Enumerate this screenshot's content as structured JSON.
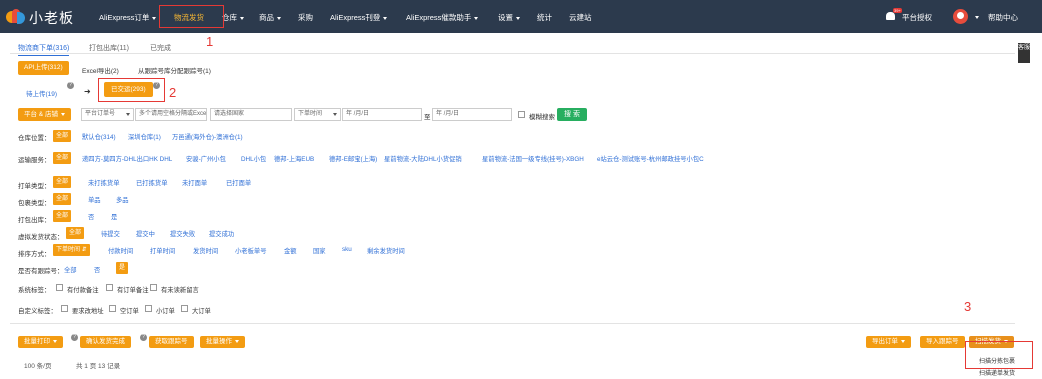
{
  "brand": "小老板",
  "nav": {
    "items": [
      {
        "label": "AliExpress订单",
        "caret": true
      },
      {
        "label": "物流发货",
        "caret": false
      },
      {
        "label": "仓库",
        "caret": true
      },
      {
        "label": "商品",
        "caret": true
      },
      {
        "label": "采购",
        "caret": false
      },
      {
        "label": "AliExpress刊登",
        "caret": true
      },
      {
        "label": "AliExpress催款助手",
        "caret": true
      },
      {
        "label": "设置",
        "caret": true
      },
      {
        "label": "统计",
        "caret": false
      },
      {
        "label": "云建站",
        "caret": false
      }
    ],
    "bell_badge": "39+",
    "auth": "平台授权",
    "help": "帮助中心"
  },
  "side_widget": "客服",
  "annotations": {
    "n1": "1",
    "n2": "2",
    "n3": "3"
  },
  "tabs": [
    {
      "label": "物流商下单(316)"
    },
    {
      "label": "打包出库(11)"
    },
    {
      "label": "已完成"
    }
  ],
  "subtabs": {
    "api": "API上传(312)",
    "excel": "Excel导出(2)",
    "from_lib": "从跟踪号库分配跟踪号(1)",
    "pending": "待上传(19)",
    "arrow": "➜",
    "submitted": "已交运(293)",
    "q": "?"
  },
  "search": {
    "platform_btn": "平台 & 店铺",
    "type_select": "平台订单号",
    "keyword_placeholder": "多个请用空格分隔或Excel",
    "country_placeholder": "请选择国家",
    "time_select": "下单时间",
    "date_from": "年 /月/日",
    "to": "至",
    "date_to": "年 /月/日",
    "fuzzy": "模糊搜索",
    "search_btn": "搜 索"
  },
  "filters": {
    "warehouse": {
      "label": "仓库位置：",
      "all": "全部",
      "options": [
        "默认仓(314)",
        "深圳仓库(1)",
        "万邑通(海外仓)-澳洲仓(1)"
      ]
    },
    "shipping": {
      "label": "运输服务：",
      "all": "全部",
      "options": [
        "递四方-莫四方-DHL出口HK DHL",
        "安骏-广州小包",
        "DHL小包",
        "德邦-上海EUB",
        "德邦-E邮宝(上海)",
        "星前物流-大陆DHL小货促销",
        "星前物流-法国一级专线(挂号)-XBGH",
        "e站云仓-测试账号-杭州邮政挂号小包C"
      ]
    },
    "print_type": {
      "label": "打单类型：",
      "all": "全部",
      "options": [
        "未打拣货单",
        "已打拣货单",
        "未打面单",
        "已打面单"
      ]
    },
    "package_type": {
      "label": "包裹类型：",
      "all": "全部",
      "options": [
        "单品",
        "多品"
      ]
    },
    "out_of_stock": {
      "label": "打包出库：",
      "all": "全部",
      "options": [
        "否",
        "是"
      ]
    },
    "virtual_ship": {
      "label": "虚拟发货状态：",
      "all": "全部",
      "options": [
        "待提交",
        "提交中",
        "提交失败",
        "提交成功"
      ]
    },
    "sort": {
      "label": "排序方式：",
      "active": "下单时间 ⇵",
      "options": [
        "付款时间",
        "打单时间",
        "发货时间",
        "小老板单号",
        "金额",
        "国家",
        "sku",
        "剩余发货时间"
      ]
    },
    "has_tracking": {
      "label": "是否有跟踪号：",
      "options": [
        "全部",
        "否"
      ],
      "active": "是"
    },
    "system_tags": {
      "label": "系统标签：",
      "options": [
        "有付款备注",
        "有订单备注",
        "有未读新留言"
      ]
    },
    "custom_tags": {
      "label": "自定义标签：",
      "options": [
        "要求改地址",
        "空订单",
        "小订单",
        "大订单"
      ]
    }
  },
  "actions": {
    "batch_print": "批量打印",
    "confirm_ship": "确认发货完成",
    "get_tracking": "获取跟踪号",
    "batch_ops": "批量操作",
    "export": "导出订单",
    "import_tracking": "导入跟踪号",
    "scan_ship": "扫描发货",
    "dropdown": [
      "扫描分拣包裹",
      "扫描递单发货"
    ]
  },
  "pagination": {
    "per_page": "100 条/页",
    "total": "共 1 页 13 记录"
  },
  "colors": {
    "nav_bg": "#2c3a4d",
    "accent": "#f39c12",
    "link": "#2f6fd6",
    "annotation": "#e53935",
    "search": "#27ae60"
  }
}
